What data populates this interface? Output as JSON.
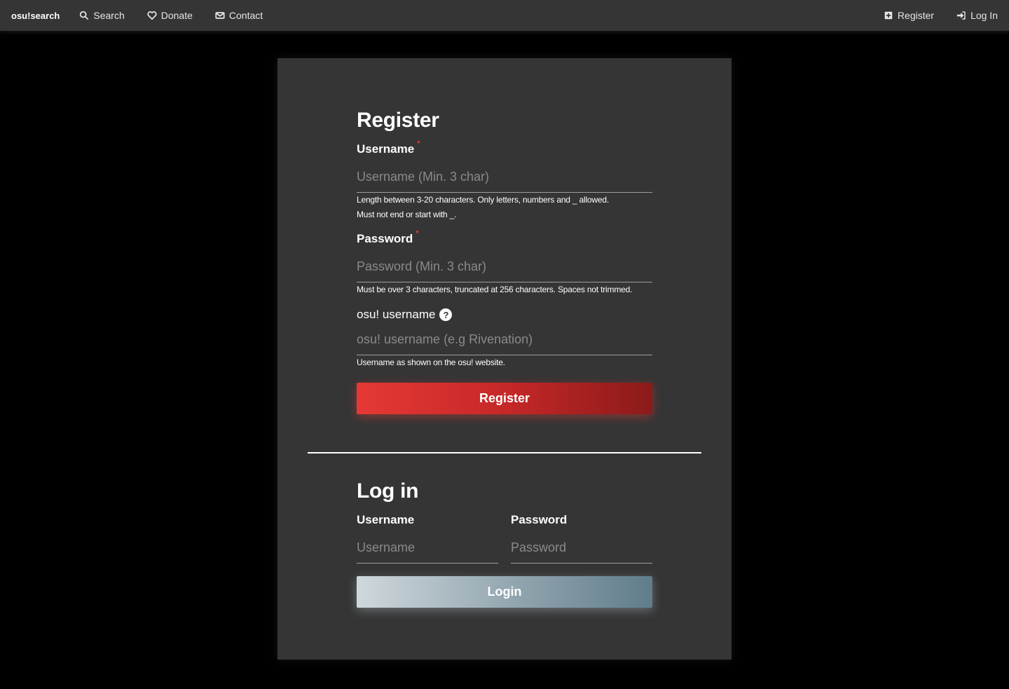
{
  "navbar": {
    "brand": "osu!search",
    "search": "Search",
    "donate": "Donate",
    "contact": "Contact",
    "register": "Register",
    "login": "Log In"
  },
  "register": {
    "title": "Register",
    "username_label": "Username",
    "username_placeholder": "Username (Min. 3 char)",
    "username_hint_line1": "Length between 3-20 characters. Only letters, numbers and _ allowed.",
    "username_hint_line2": "Must not end or start with _.",
    "password_label": "Password",
    "password_placeholder": "Password (Min. 3 char)",
    "password_hint": "Must be over 3 characters, truncated at 256 characters. Spaces not trimmed.",
    "osu_label": "osu! username",
    "osu_placeholder": "osu! username (e.g Rivenation)",
    "osu_hint": "Username as shown on the osu! website.",
    "required_mark": "*",
    "help_mark": "?",
    "button": "Register"
  },
  "login": {
    "title": "Log in",
    "username_label": "Username",
    "username_placeholder": "Username",
    "password_label": "Password",
    "password_placeholder": "Password",
    "button": "Login"
  },
  "colors": {
    "navbar_bg": "#353535",
    "card_bg": "#353535",
    "page_bg": "#000000",
    "register_accent": "#e53935",
    "login_accent": "#90a4ae"
  }
}
